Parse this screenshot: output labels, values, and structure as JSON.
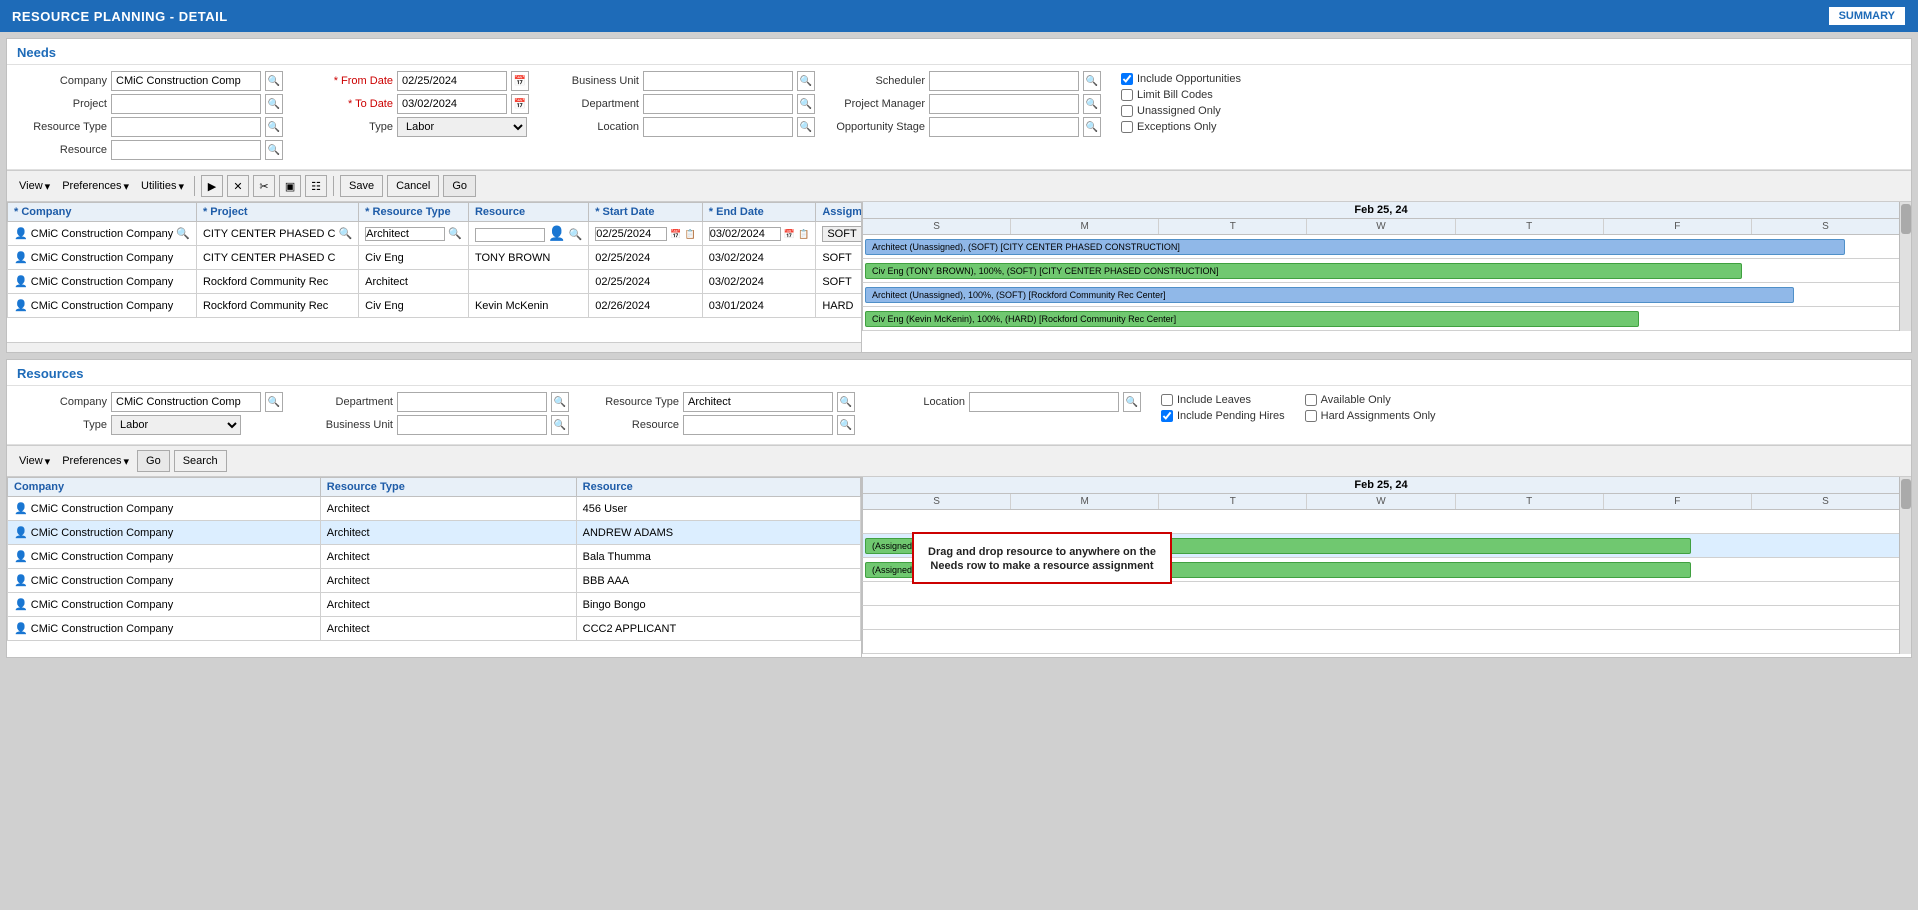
{
  "app": {
    "title": "RESOURCE PLANNING - DETAIL",
    "summary_btn": "SUMMARY"
  },
  "needs": {
    "section_title": "Needs",
    "filters": {
      "company_label": "Company",
      "company_value": "CMiC Construction Comp",
      "from_date_label": "* From Date",
      "from_date_value": "02/25/2024",
      "to_date_label": "* To Date",
      "to_date_value": "03/02/2024",
      "business_unit_label": "Business Unit",
      "department_label": "Department",
      "location_label": "Location",
      "scheduler_label": "Scheduler",
      "project_manager_label": "Project Manager",
      "opportunity_stage_label": "Opportunity Stage",
      "project_label": "Project",
      "resource_type_label": "Resource Type",
      "resource_label": "Resource",
      "type_label": "Type",
      "type_value": "Labor",
      "include_opportunities_label": "Include Opportunities",
      "include_opportunities_checked": true,
      "limit_bill_codes_label": "Limit Bill Codes",
      "limit_bill_codes_checked": false,
      "unassigned_only_label": "Unassigned Only",
      "unassigned_only_checked": false,
      "exceptions_only_label": "Exceptions Only",
      "exceptions_only_checked": false
    },
    "toolbar": {
      "view_label": "View",
      "preferences_label": "Preferences",
      "utilities_label": "Utilities",
      "save_label": "Save",
      "cancel_label": "Cancel",
      "go_label": "Go"
    },
    "table": {
      "columns": [
        "* Company",
        "* Project",
        "* Resource Type",
        "Resource",
        "* Start Date",
        "* End Date",
        "Assigment Type"
      ],
      "rows": [
        {
          "company": "CMiC Construction Company",
          "project": "CITY CENTER PHASED C",
          "resource_type": "Architect",
          "resource": "",
          "start_date": "02/25/2024",
          "end_date": "03/02/2024",
          "assignment_type": "SOFT",
          "editing": true
        },
        {
          "company": "CMiC Construction Company",
          "project": "CITY CENTER PHASED C",
          "resource_type": "Civ Eng",
          "resource": "TONY BROWN",
          "start_date": "02/25/2024",
          "end_date": "03/02/2024",
          "assignment_type": "SOFT",
          "editing": false
        },
        {
          "company": "CMiC Construction Company",
          "project": "Rockford Community Rec",
          "resource_type": "Architect",
          "resource": "",
          "start_date": "02/25/2024",
          "end_date": "03/02/2024",
          "assignment_type": "SOFT",
          "editing": false
        },
        {
          "company": "CMiC Construction Company",
          "project": "Rockford Community Rec",
          "resource_type": "Civ Eng",
          "resource": "Kevin McKenin",
          "start_date": "02/26/2024",
          "end_date": "03/01/2024",
          "assignment_type": "HARD",
          "editing": false
        }
      ]
    },
    "gantt": {
      "date_header": "Feb 25, 24",
      "days": [
        "S",
        "M",
        "T",
        "W",
        "T",
        "F",
        "S"
      ],
      "bars": [
        {
          "text": "Architect (Unassigned), (SOFT) [CITY CENTER PHASED CONSTRUCTION]",
          "type": "blue",
          "width_pct": 95
        },
        {
          "text": "Civ Eng (TONY BROWN), 100%, (SOFT) [CITY CENTER PHASED CONSTRUCTION]",
          "type": "green",
          "width_pct": 85
        },
        {
          "text": "Architect (Unassigned), 100%, (SOFT) [Rockford Community Rec Center]",
          "type": "blue",
          "width_pct": 90
        },
        {
          "text": "Civ Eng (Kevin McKenin), 100%, (HARD) [Rockford Community Rec Center]",
          "type": "green",
          "width_pct": 75
        }
      ]
    }
  },
  "resources": {
    "section_title": "Resources",
    "filters": {
      "company_label": "Company",
      "company_value": "CMiC Construction Comp",
      "department_label": "Department",
      "resource_type_label": "Resource Type",
      "resource_type_value": "Architect",
      "location_label": "Location",
      "type_label": "Type",
      "type_value": "Labor",
      "business_unit_label": "Business Unit",
      "resource_label": "Resource",
      "include_leaves_label": "Include Leaves",
      "include_leaves_checked": false,
      "include_pending_hires_label": "Include Pending Hires",
      "include_pending_hires_checked": true,
      "available_only_label": "Available Only",
      "available_only_checked": false,
      "hard_assignments_only_label": "Hard Assignments Only",
      "hard_assignments_only_checked": false
    },
    "toolbar": {
      "view_label": "View",
      "preferences_label": "Preferences",
      "go_label": "Go",
      "search_label": "Search"
    },
    "table": {
      "columns": [
        "Company",
        "Resource Type",
        "Resource"
      ],
      "rows": [
        {
          "company": "CMiC Construction Company",
          "resource_type": "Architect",
          "resource": "456 User",
          "selected": false
        },
        {
          "company": "CMiC Construction Company",
          "resource_type": "Architect",
          "resource": "ANDREW ADAMS",
          "selected": true
        },
        {
          "company": "CMiC Construction Company",
          "resource_type": "Architect",
          "resource": "Bala Thumma",
          "selected": false
        },
        {
          "company": "CMiC Construction Company",
          "resource_type": "Architect",
          "resource": "BBB AAA",
          "selected": false
        },
        {
          "company": "CMiC Construction Company",
          "resource_type": "Architect",
          "resource": "Bingo Bongo",
          "selected": false
        },
        {
          "company": "CMiC Construction Company",
          "resource_type": "Architect",
          "resource": "CCC2 APPLICANT",
          "selected": false
        }
      ]
    },
    "gantt": {
      "date_header": "Feb 25, 24",
      "days": [
        "S",
        "M",
        "T",
        "W",
        "T",
        "F",
        "S"
      ],
      "bars": [
        {
          "text": "",
          "type": "none"
        },
        {
          "text": "(Assigned), 100% (HARD)",
          "type": "green",
          "width_pct": 80
        },
        {
          "text": "(Assigned), 100% (HARD)",
          "type": "green",
          "width_pct": 80
        },
        {
          "text": "",
          "type": "none"
        },
        {
          "text": "",
          "type": "none"
        },
        {
          "text": "",
          "type": "none"
        }
      ]
    },
    "callout": {
      "text": "Drag and drop resource to anywhere on the Needs row to make a resource assignment"
    }
  }
}
